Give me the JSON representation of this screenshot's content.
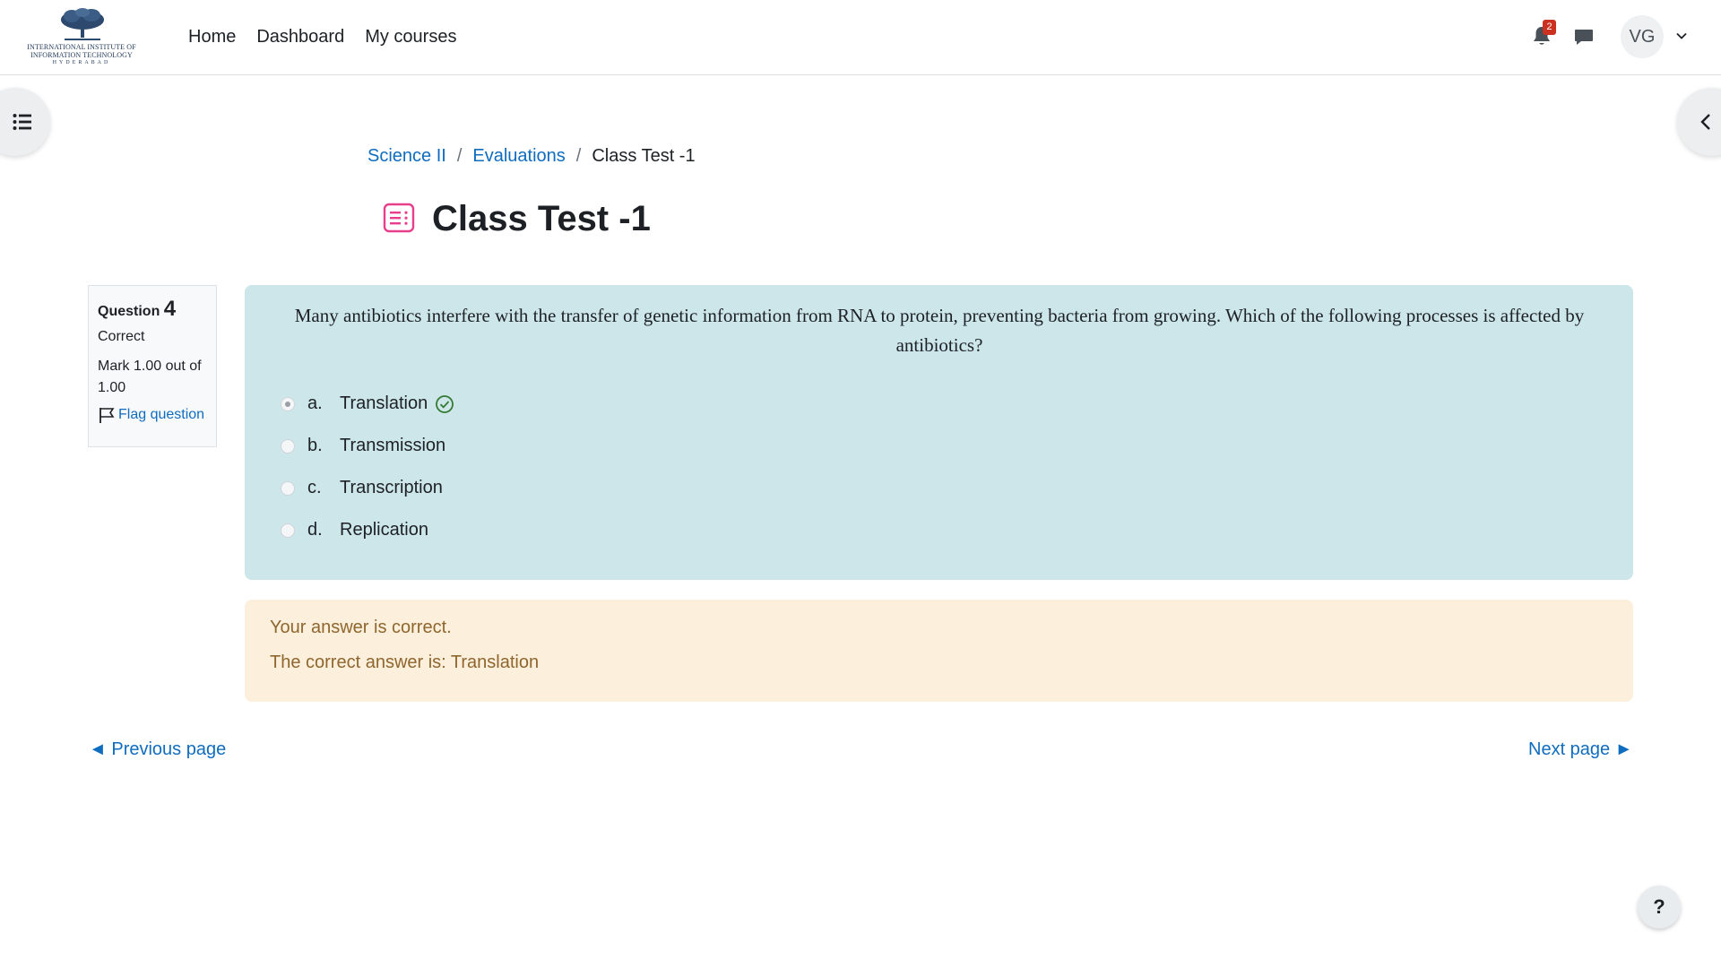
{
  "logo": {
    "line1": "INTERNATIONAL INSTITUTE OF",
    "line2": "INFORMATION TECHNOLOGY",
    "line3": "HYDERABAD"
  },
  "nav": {
    "items": [
      {
        "label": "Home"
      },
      {
        "label": "Dashboard"
      },
      {
        "label": "My courses"
      }
    ],
    "notification_count": "2",
    "avatar_initials": "VG"
  },
  "breadcrumb": {
    "items": [
      {
        "label": "Science II"
      },
      {
        "label": "Evaluations"
      }
    ],
    "current": "Class Test -1"
  },
  "page": {
    "title": "Class Test -1"
  },
  "question": {
    "label": "Question",
    "number": "4",
    "state": "Correct",
    "grade": "Mark 1.00 out of 1.00",
    "flag_label": "Flag question",
    "text": "Many antibiotics interfere with the transfer of genetic information from RNA to protein, preventing bacteria from growing. Which of the following processes is affected by antibiotics?",
    "answers": [
      {
        "letter": "a.",
        "text": "Translation",
        "selected": true,
        "correct": true
      },
      {
        "letter": "b.",
        "text": "Transmission",
        "selected": false
      },
      {
        "letter": "c.",
        "text": "Transcription",
        "selected": false
      },
      {
        "letter": "d.",
        "text": "Replication",
        "selected": false
      }
    ]
  },
  "feedback": {
    "line1": "Your answer is correct.",
    "line2": "The correct answer is: Translation"
  },
  "pagination": {
    "prev": "◄ Previous page",
    "next": "Next page ►"
  },
  "help": {
    "label": "?"
  },
  "colors": {
    "link": "#0f6cbf",
    "question_bg": "#cce6ea",
    "feedback_bg": "#fcefdc",
    "feedback_text": "#8e662e",
    "badge": "#ca3120",
    "correct": "#357a32",
    "page_icon": "#e83e8c"
  }
}
